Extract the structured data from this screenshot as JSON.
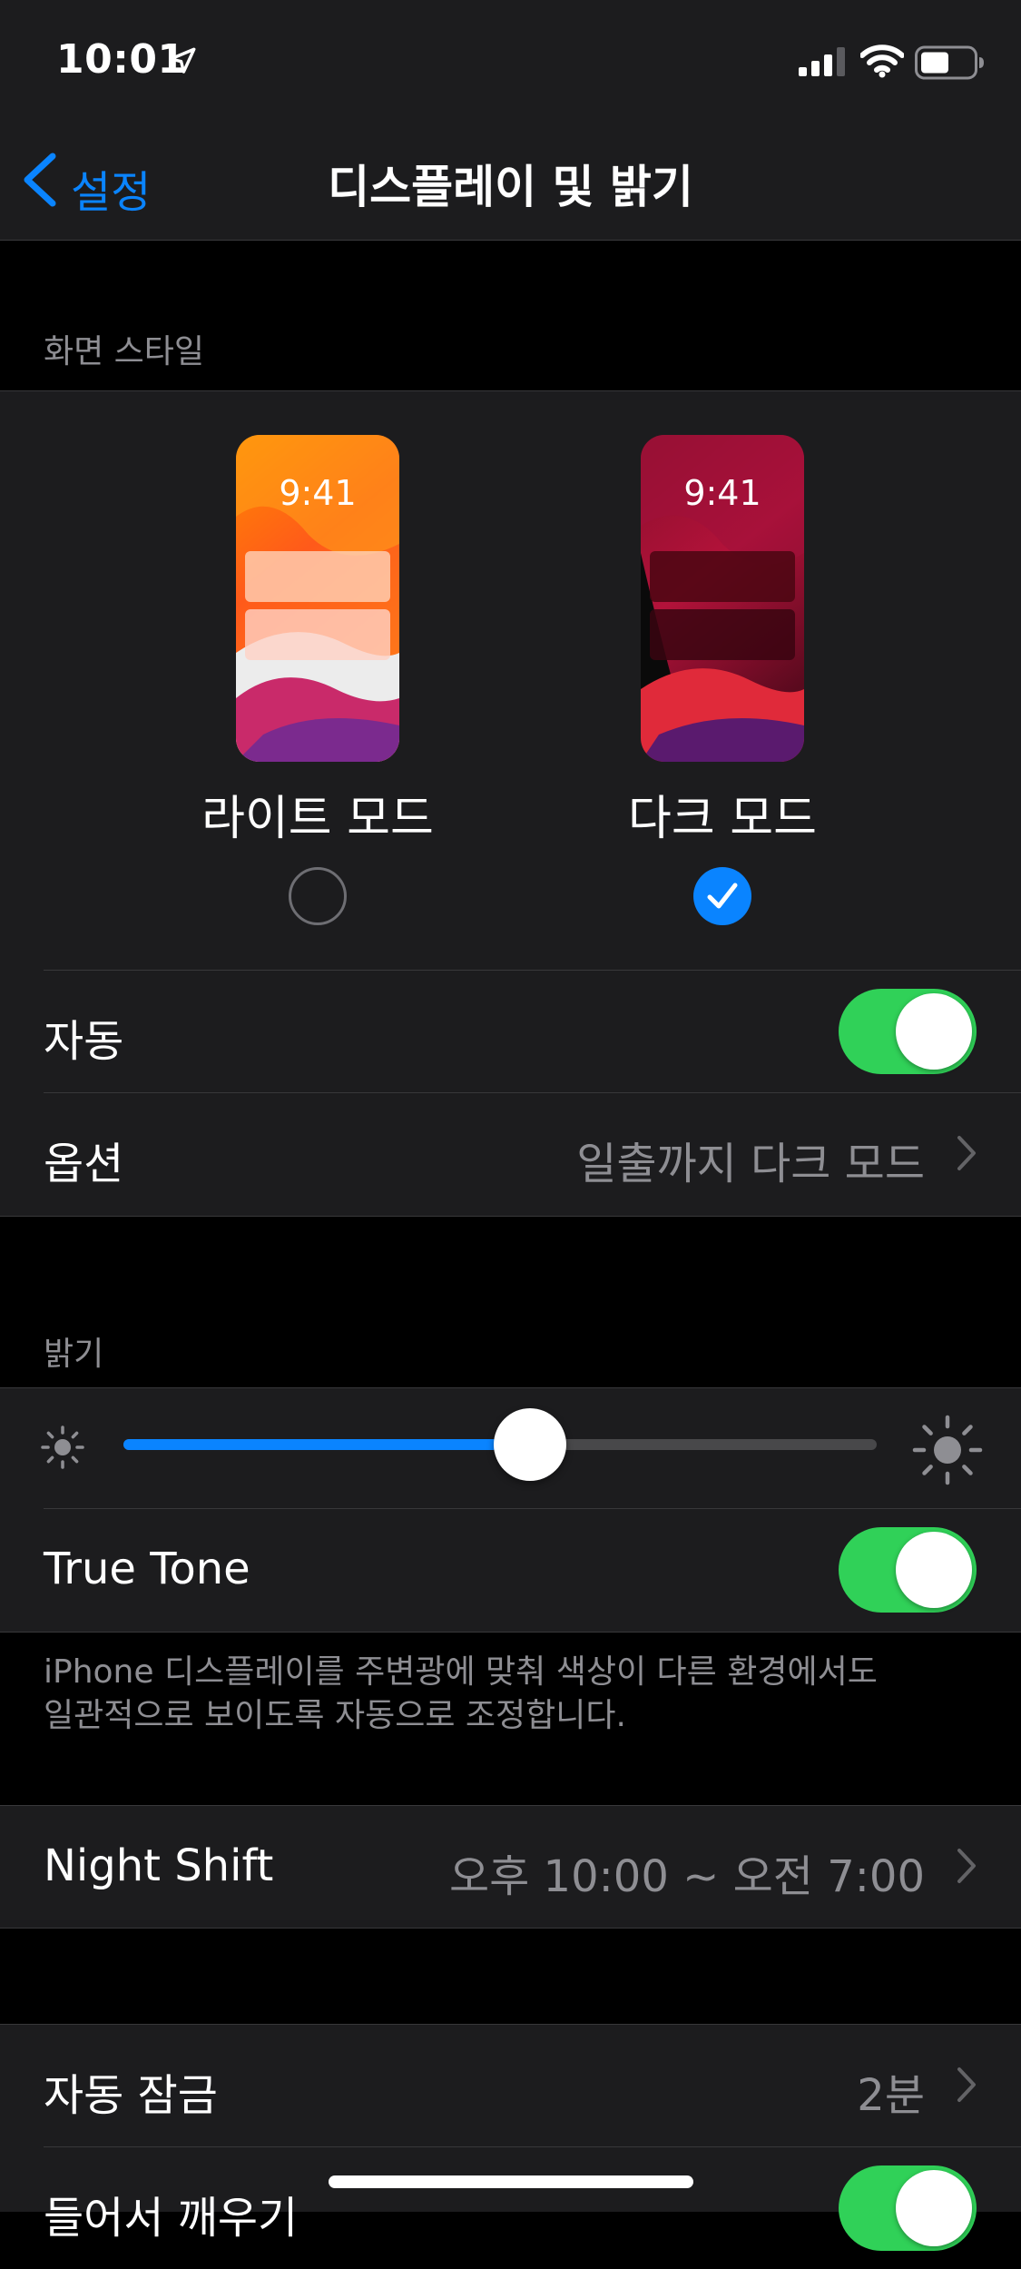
{
  "status_bar": {
    "time": "10:01",
    "icons": [
      "location-arrow-icon",
      "cellular-signal-icon",
      "wifi-icon",
      "battery-icon"
    ]
  },
  "nav": {
    "back_label": "설정",
    "title": "디스플레이 및 밝기"
  },
  "appearance": {
    "section_header": "화면 스타일",
    "light": {
      "preview_time": "9:41",
      "label": "라이트 모드",
      "selected": false
    },
    "dark": {
      "preview_time": "9:41",
      "label": "다크 모드",
      "selected": true
    },
    "auto_label": "자동",
    "auto_on": true,
    "options_label": "옵션",
    "options_value": "일출까지 다크 모드"
  },
  "brightness": {
    "section_header": "밝기",
    "level": 0.54,
    "true_tone_label": "True Tone",
    "true_tone_on": true,
    "true_tone_footer_line1": "iPhone 디스플레이를 주변광에 맞춰 색상이 다른 환경에서도",
    "true_tone_footer_line2": "일관적으로 보이도록 자동으로 조정합니다."
  },
  "night_shift": {
    "label": "Night Shift",
    "value": "오후 10:00 ~ 오전 7:00"
  },
  "auto_lock": {
    "label": "자동 잠금",
    "value": "2분"
  },
  "raise_to_wake": {
    "label": "들어서 깨우기",
    "on": true
  },
  "colors": {
    "accent": "#0a84ff",
    "toggle_on": "#30d158",
    "group_bg": "#1c1c1e",
    "secondary_text": "#8e8e93"
  }
}
